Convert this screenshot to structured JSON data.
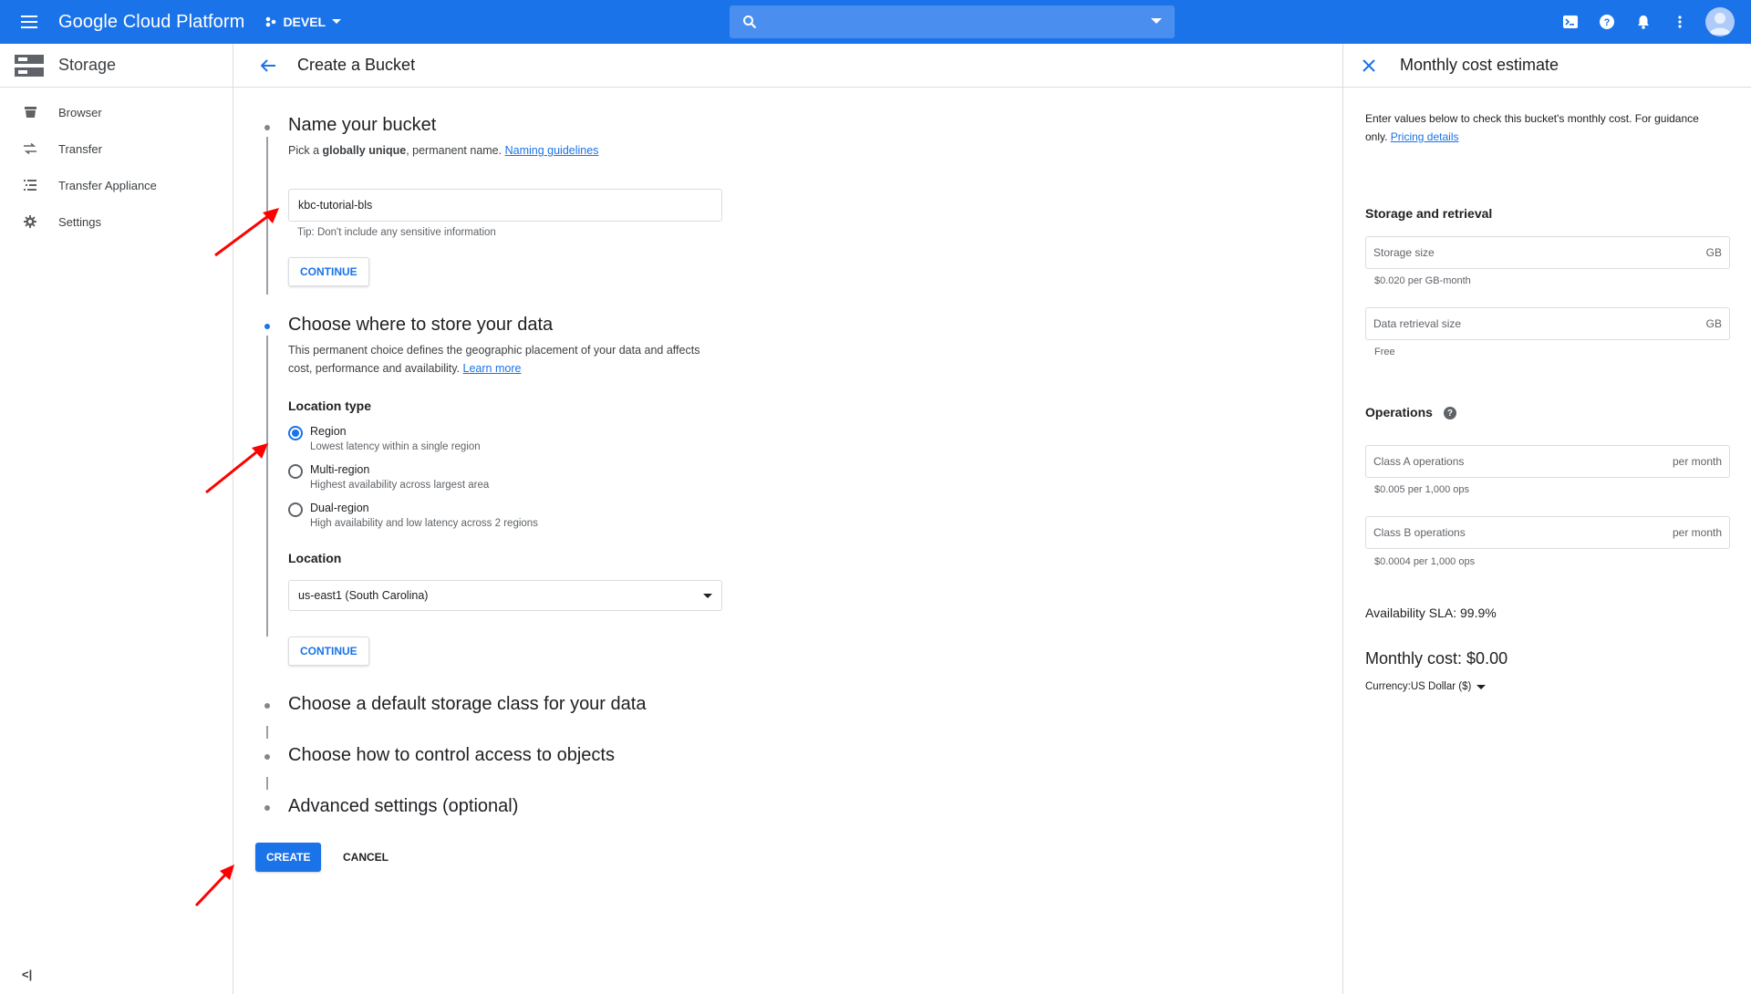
{
  "topbar": {
    "brand": "Google Cloud Platform",
    "project": "DEVEL"
  },
  "leftnav": {
    "title": "Storage",
    "items": [
      {
        "label": "Browser"
      },
      {
        "label": "Transfer"
      },
      {
        "label": "Transfer Appliance"
      },
      {
        "label": "Settings"
      }
    ],
    "collapse_label": "<|"
  },
  "main": {
    "page_title": "Create a Bucket",
    "steps": {
      "name": {
        "title": "Name your bucket",
        "desc_pre": "Pick a ",
        "desc_bold": "globally unique",
        "desc_post": ", permanent name. ",
        "desc_link": "Naming guidelines",
        "input_value": "kbc-tutorial-bls",
        "tip": "Tip: Don't include any sensitive information",
        "continue": "CONTINUE"
      },
      "location": {
        "title": "Choose where to store your data",
        "desc_line1": "This permanent choice defines the geographic placement of your data and affects",
        "desc_line2": "cost, performance and availability. ",
        "desc_link": "Learn more",
        "location_type_label": "Location type",
        "options": [
          {
            "label": "Region",
            "sub": "Lowest latency within a single region",
            "selected": true
          },
          {
            "label": "Multi-region",
            "sub": "Highest availability across largest area",
            "selected": false
          },
          {
            "label": "Dual-region",
            "sub": "High availability and low latency across 2 regions",
            "selected": false
          }
        ],
        "location_label": "Location",
        "location_value": "us-east1 (South Carolina)",
        "continue": "CONTINUE"
      },
      "storage_class": {
        "title": "Choose a default storage class for your data"
      },
      "access": {
        "title": "Choose how to control access to objects"
      },
      "advanced": {
        "title": "Advanced settings (optional)"
      }
    },
    "create": "CREATE",
    "cancel": "CANCEL"
  },
  "cost_panel": {
    "title": "Monthly cost estimate",
    "intro_line1": "Enter values below to check this bucket's monthly cost. For guidance",
    "intro_line2": "only. ",
    "intro_link": "Pricing details",
    "storage_heading": "Storage and retrieval",
    "storage_size": {
      "placeholder": "Storage size",
      "suffix": "GB",
      "hint": "$0.020 per GB-month"
    },
    "retrieval_size": {
      "placeholder": "Data retrieval size",
      "suffix": "GB",
      "hint": "Free"
    },
    "operations_heading": "Operations",
    "class_a": {
      "placeholder": "Class A operations",
      "suffix": "per month",
      "hint": "$0.005 per 1,000 ops"
    },
    "class_b": {
      "placeholder": "Class B operations",
      "suffix": "per month",
      "hint": "$0.0004 per 1,000 ops"
    },
    "sla": "Availability SLA: 99.9%",
    "monthly_cost": "Monthly cost: $0.00",
    "currency_label": "Currency:",
    "currency_value": "US Dollar ($)"
  },
  "colors": {
    "accent": "#1a73e8",
    "annotation_arrow": "#ff0000"
  }
}
